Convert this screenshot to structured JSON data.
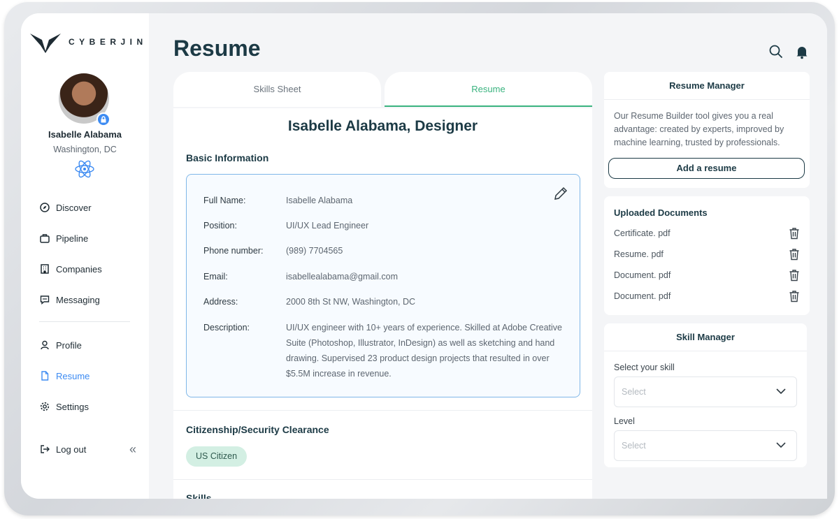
{
  "brand": {
    "name": "CYBERJIN"
  },
  "user": {
    "name": "Isabelle Alabama",
    "location": "Washington, DC"
  },
  "sidebar": {
    "items": [
      {
        "label": "Discover",
        "icon": "compass-icon"
      },
      {
        "label": "Pipeline",
        "icon": "briefcase-icon"
      },
      {
        "label": "Companies",
        "icon": "building-icon"
      },
      {
        "label": "Messaging",
        "icon": "chat-icon"
      },
      {
        "label": "Profile",
        "icon": "user-icon"
      },
      {
        "label": "Resume",
        "icon": "document-icon",
        "active": true
      },
      {
        "label": "Settings",
        "icon": "gear-icon"
      },
      {
        "label": "Log out",
        "icon": "logout-icon"
      }
    ]
  },
  "header": {
    "title": "Resume"
  },
  "tabs": [
    {
      "label": "Skills Sheet"
    },
    {
      "label": "Resume",
      "active": true
    }
  ],
  "resume": {
    "heading": "Isabelle Alabama, Designer",
    "basic_title": "Basic Information",
    "fields": [
      {
        "label": "Full Name:",
        "value": "Isabelle Alabama"
      },
      {
        "label": "Position:",
        "value": "UI/UX Lead Engineer"
      },
      {
        "label": "Phone number:",
        "value": "(989) 7704565"
      },
      {
        "label": "Email:",
        "value": "isabellealabama@gmail.com"
      },
      {
        "label": "Address:",
        "value": "2000 8th St NW, Washington, DC"
      },
      {
        "label": "Description:",
        "value": "UI/UX engineer with 10+ years of experience. Skilled at Adobe Creative Suite (Photoshop, Illustrator, InDesign) as well as sketching and hand drawing. Supervised 23 product design projects that resulted in over $5.5M increase in revenue."
      }
    ],
    "citizenship_title": "Citizenship/Security Clearance",
    "citizenship_chip": "US Citizen",
    "skills_title": "Skills"
  },
  "resume_manager": {
    "title": "Resume Manager",
    "description": "Our Resume Builder tool gives you a real advantage: created by experts, improved by machine learning, trusted by professionals.",
    "button": "Add a resume"
  },
  "uploaded": {
    "title": "Uploaded Documents",
    "docs": [
      "Certificate. pdf",
      "Resume. pdf",
      "Document. pdf",
      "Document. pdf"
    ]
  },
  "skill_manager": {
    "title": "Skill Manager",
    "skill_label": "Select your skill",
    "skill_placeholder": "Select",
    "level_label": "Level",
    "level_placeholder": "Select"
  },
  "colors": {
    "accent_green": "#3ab37f",
    "accent_blue": "#3d8bf2",
    "dark": "#1c3a45"
  }
}
